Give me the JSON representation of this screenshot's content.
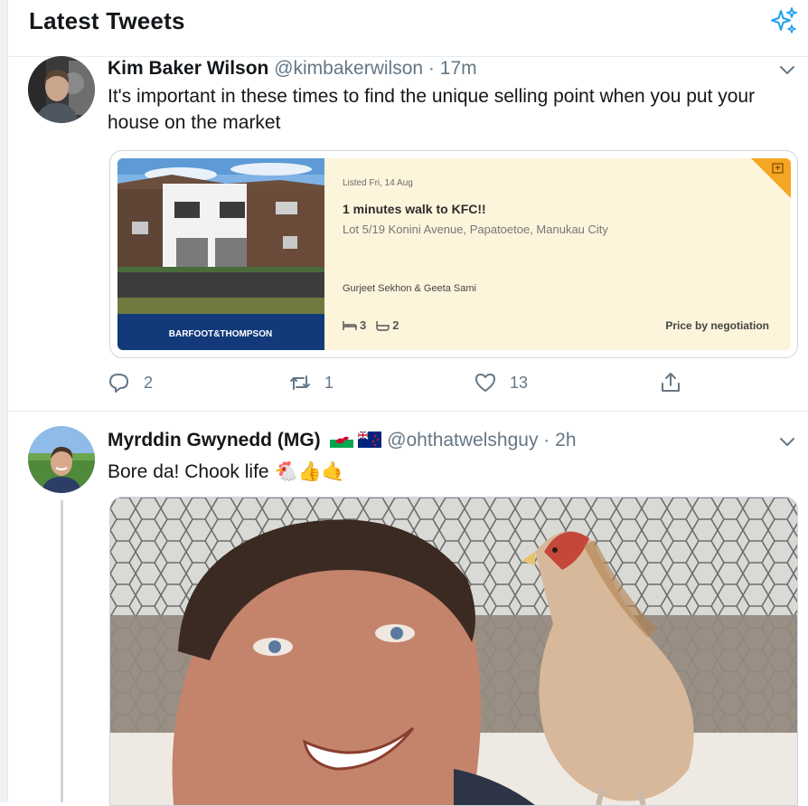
{
  "header": {
    "title": "Latest Tweets",
    "icon": "sparkle-icon"
  },
  "tweets": [
    {
      "name": "Kim Baker Wilson",
      "handle": "@kimbakerwilson",
      "separator": "·",
      "time": "17m",
      "text": "It's important in these times to find the unique selling point when you put your house on the market",
      "card": {
        "brand": "BARFOOT&THOMPSON",
        "listed": "Listed Fri, 14 Aug",
        "headline": "1 minutes walk to KFC!!",
        "address": "Lot 5/19 Konini Avenue, Papatoetoe, Manukau City",
        "agents": "Gurjeet Sekhon & Geeta Sami",
        "bedrooms": "3",
        "bathrooms": "2",
        "price": "Price by negotiation"
      },
      "actions": {
        "replies": "2",
        "retweets": "1",
        "likes": "13"
      }
    },
    {
      "name": "Myrddin Gwynedd (MG)",
      "handle": "@ohthatwelshguy",
      "separator": "·",
      "time": "2h",
      "text": "Bore da! Chook life",
      "emoji": "🐔👍🤙"
    }
  ],
  "colors": {
    "accent": "#1da1f2",
    "secondary_text": "#657786",
    "card_background": "#fdf4dc",
    "brand_blue": "#123a7a"
  }
}
